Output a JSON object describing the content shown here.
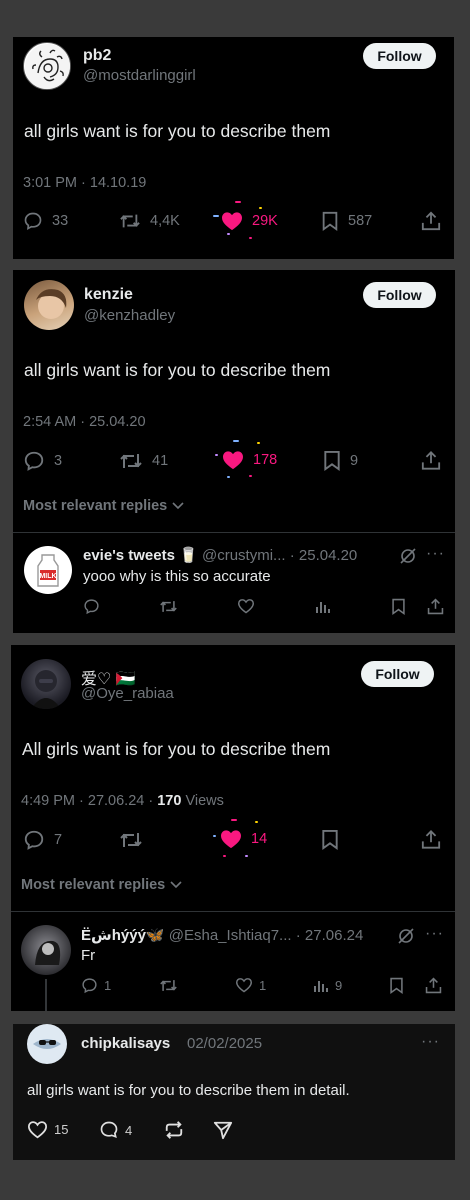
{
  "tweets": [
    {
      "name": "pb2",
      "handle": "@mostdarlinggirl",
      "follow_label": "Follow",
      "text": "all girls want is for you to describe them",
      "meta": "3:01 PM · 14.10.19",
      "actions": {
        "replies": "33",
        "reposts": "4,4K",
        "likes": "29K",
        "bookmarks": "587"
      }
    },
    {
      "name": "kenzie",
      "handle": "@kenzhadley",
      "follow_label": "Follow",
      "text": "all girls want is for you to describe them",
      "meta": "2:54 AM · 25.04.20",
      "actions": {
        "replies": "3",
        "reposts": "41",
        "likes": "178",
        "bookmarks": "9"
      },
      "relevant_label": "Most relevant replies",
      "reply": {
        "name": "evie's tweets 🥛",
        "handle": "@crustymi...",
        "date": "· 25.04.20",
        "text": "yooo why is this so accurate",
        "avatar_label": "MILK"
      }
    },
    {
      "name": "爱♡ 🇵🇸",
      "handle": "@Oye_rabiaa",
      "follow_label": "Follow",
      "text": "All girls want is for you to describe them",
      "meta_prefix": "4:49 PM · 27.06.24 · ",
      "views_count": "170",
      "views_label": " Views",
      "actions": {
        "replies": "7",
        "likes": "14"
      },
      "relevant_label": "Most relevant replies",
      "reply": {
        "name": "Ëشhýýý🦋",
        "handle": "@Esha_Ishtiaq7...",
        "date": "· 27.06.24",
        "text": "Fr",
        "replies": "1",
        "likes": "1",
        "views": "9"
      }
    }
  ],
  "threads_post": {
    "name": "chipkalisays",
    "date": "02/02/2025",
    "text": "all girls want is for you to describe them in detail.",
    "likes": "15",
    "replies": "4",
    "more": "···"
  },
  "icons": [
    "reply-icon",
    "repost-icon",
    "heart-icon",
    "bookmark-icon",
    "share-icon",
    "views-icon",
    "grok-icon",
    "more-icon",
    "send-icon",
    "chevron-down-icon"
  ],
  "colors": {
    "like_pink": "#f91880",
    "muted": "#71767b",
    "background": "#000000",
    "outer": "#3a3a3a"
  }
}
